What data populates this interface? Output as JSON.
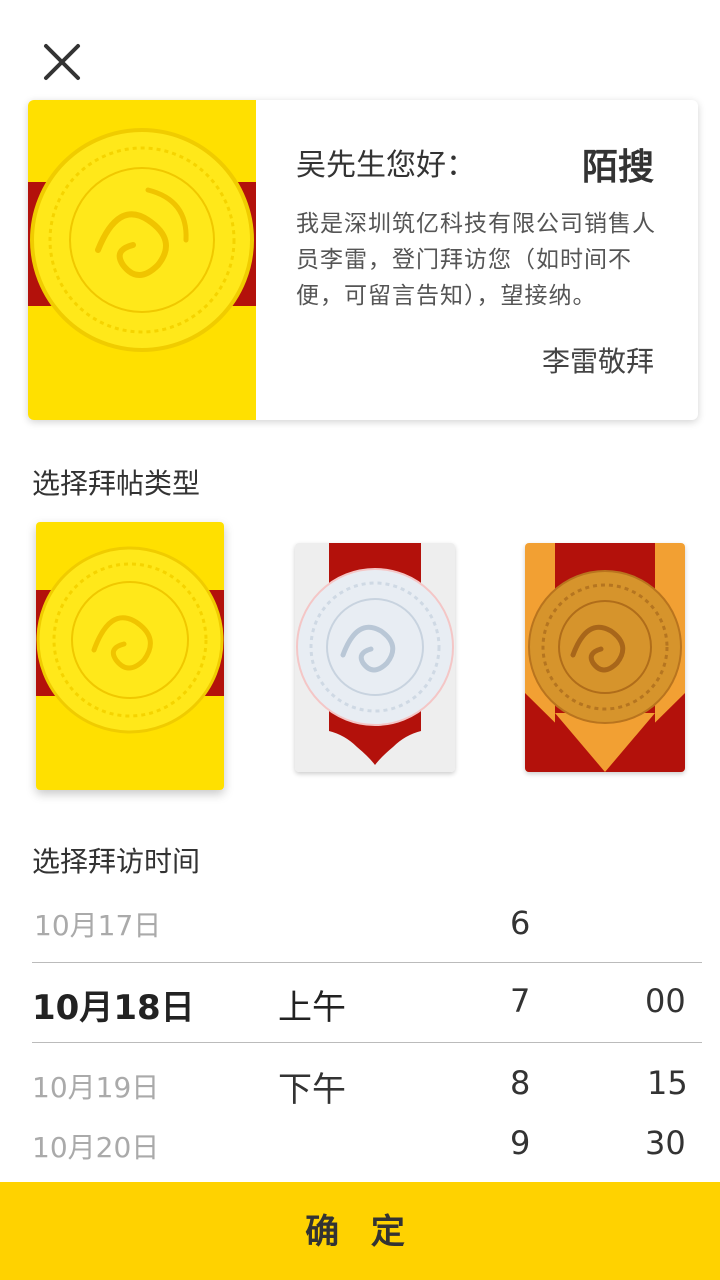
{
  "header": {
    "close_icon": "close-icon"
  },
  "card": {
    "greeting": "吴先生您好：",
    "brand": "陌搜",
    "message": "我是深圳筑亿科技有限公司销售人员李雷，登门拜访您（如时间不便，可留言告知），望接纳。",
    "signature": "李雷敬拜"
  },
  "type_section": {
    "title": "选择拜帖类型",
    "options": [
      {
        "name": "yellow-red",
        "selected": true
      },
      {
        "name": "white-red",
        "selected": false
      },
      {
        "name": "orange-red",
        "selected": false
      }
    ]
  },
  "time_section": {
    "title": "选择拜访时间",
    "dates": [
      "10月17日",
      "10月18日",
      "10月19日",
      "10月20日"
    ],
    "selected_date": "10月18日",
    "periods": [
      "上午",
      "下午"
    ],
    "selected_period": "上午",
    "hours": [
      "6",
      "7",
      "8",
      "9"
    ],
    "selected_hour": "7",
    "minutes": [
      "00",
      "15",
      "30"
    ],
    "selected_minute": "00"
  },
  "footer": {
    "confirm_label": "确 定"
  },
  "colors": {
    "accent": "#ffd200",
    "card_yellow": "#ffe000",
    "card_red": "#b3110b",
    "card_orange": "#f2a033",
    "medallion_gold": "#c9892a"
  }
}
